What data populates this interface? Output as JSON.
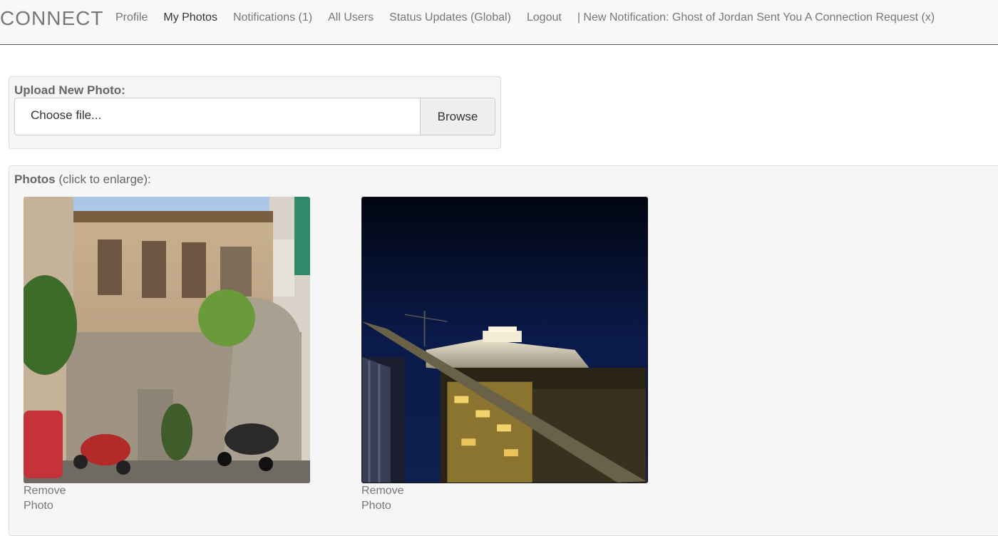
{
  "navbar": {
    "brand": "CONNECT",
    "links": [
      {
        "label": "Profile"
      },
      {
        "label": "My Photos"
      },
      {
        "label": "Notifications (1)"
      },
      {
        "label": "All Users"
      },
      {
        "label": "Status Updates (Global)"
      },
      {
        "label": "Logout"
      }
    ],
    "notice": "| New Notification: Ghost of Jordan Sent You A Connection Request (x)"
  },
  "upload": {
    "label": "Upload New Photo:",
    "file_placeholder": "Choose file...",
    "browse_label": "Browse"
  },
  "photos": {
    "heading_bold": "Photos",
    "heading_rest": " (click to enlarge):",
    "items": [
      {
        "description_icon": "building-scooters-photo",
        "remove_label": "Remove Photo"
      },
      {
        "description_icon": "acropolis-night-photo",
        "remove_label": "Remove Photo"
      }
    ]
  },
  "colors": {
    "navbar_bg": "#f8f8f8",
    "panel_bg": "#f5f5f5",
    "text": "#777777"
  }
}
